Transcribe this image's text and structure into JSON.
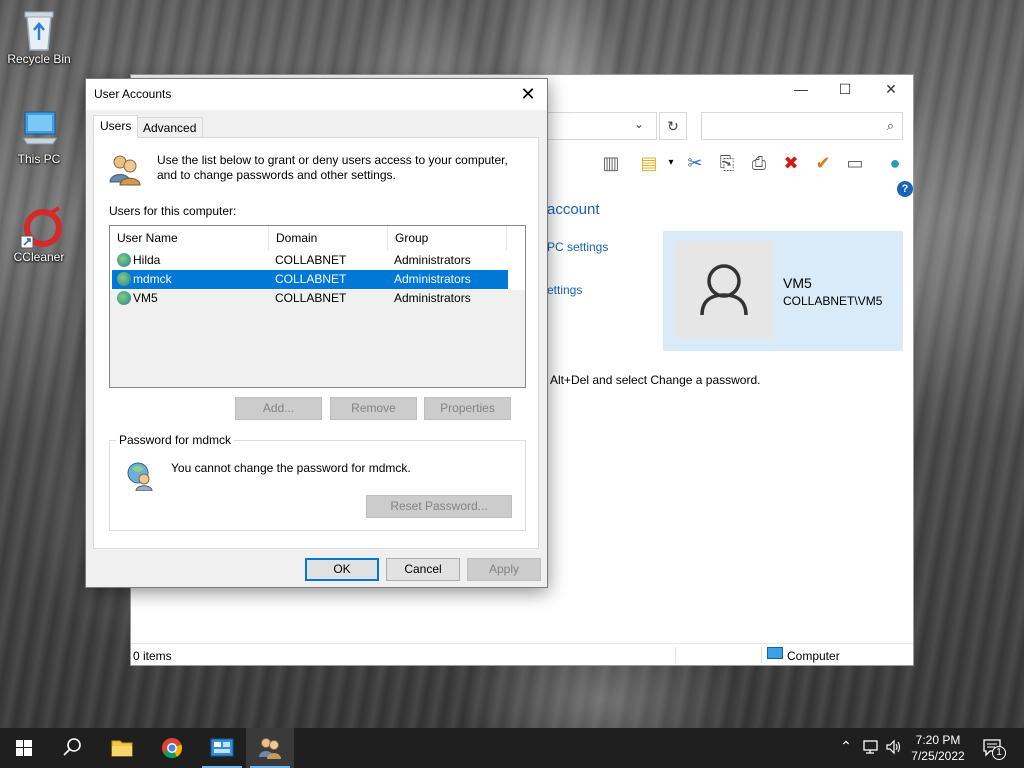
{
  "desktop": {
    "icons": [
      {
        "label": "Recycle Bin"
      },
      {
        "label": "This PC"
      },
      {
        "label": "CCleaner"
      }
    ]
  },
  "explorer": {
    "heading": "account",
    "link1": "PC settings",
    "link2": "ettings",
    "ctrl_alt_del_text": "Alt+Del and select Change a password.",
    "user_card": {
      "name": "VM5",
      "account": "COLLABNET\\VM5"
    },
    "status_items": "0 items",
    "status_location": "Computer",
    "help_glyph": "?"
  },
  "dialog": {
    "title": "User Accounts",
    "tabs": [
      {
        "label": "Users"
      },
      {
        "label": "Advanced"
      }
    ],
    "intro_text_line1": "Use the list below to grant or deny users access to your computer,",
    "intro_text_line2": "and to change passwords and other settings.",
    "users_label": "Users for this computer:",
    "columns": [
      "User Name",
      "Domain",
      "Group"
    ],
    "users": [
      {
        "name": "Hilda",
        "domain": "COLLABNET",
        "group": "Administrators"
      },
      {
        "name": "mdmck",
        "domain": "COLLABNET",
        "group": "Administrators"
      },
      {
        "name": "VM5",
        "domain": "COLLABNET",
        "group": "Administrators"
      }
    ],
    "add_label": "Add...",
    "remove_label": "Remove",
    "properties_label": "Properties",
    "password_group_label": "Password for mdmck",
    "password_message": "You cannot change the password for mdmck.",
    "reset_password_label": "Reset Password...",
    "ok_label": "OK",
    "cancel_label": "Cancel",
    "apply_label": "Apply"
  },
  "taskbar": {
    "time": "7:20 PM",
    "date": "7/25/2022",
    "notification_count": "1"
  }
}
